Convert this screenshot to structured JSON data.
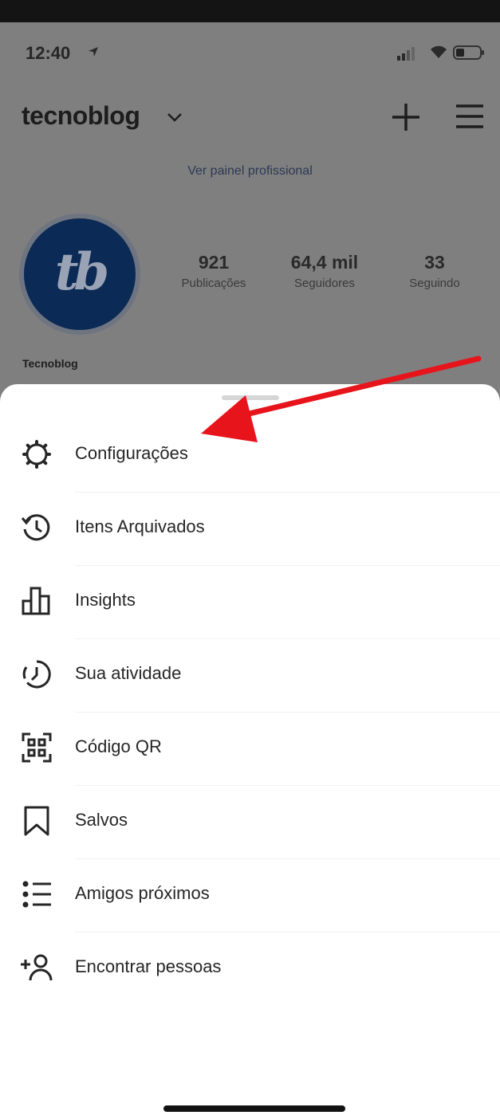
{
  "status_bar": {
    "time": "12:40",
    "icons": [
      "location-arrow-icon",
      "signal-icon",
      "wifi-icon",
      "battery-icon"
    ]
  },
  "header": {
    "account_name": "tecnoblog",
    "icons": [
      "chevron-down-icon",
      "plus-icon",
      "hamburger-menu-icon"
    ]
  },
  "professional_panel": "Ver painel profissional",
  "profile": {
    "avatar_text": "tb",
    "display_name": "Tecnoblog",
    "stats": [
      {
        "value": "921",
        "label": "Publicações"
      },
      {
        "value": "64,4 mil",
        "label": "Seguidores"
      },
      {
        "value": "33",
        "label": "Seguindo"
      }
    ]
  },
  "menu": {
    "items": [
      {
        "label": "Configurações",
        "icon": "settings-gear-icon"
      },
      {
        "label": "Itens Arquivados",
        "icon": "archive-history-icon"
      },
      {
        "label": "Insights",
        "icon": "bar-chart-icon"
      },
      {
        "label": "Sua atividade",
        "icon": "activity-clock-icon"
      },
      {
        "label": "Código QR",
        "icon": "qr-code-icon"
      },
      {
        "label": "Salvos",
        "icon": "bookmark-icon"
      },
      {
        "label": "Amigos próximos",
        "icon": "close-friends-list-icon"
      },
      {
        "label": "Encontrar pessoas",
        "icon": "add-person-icon"
      }
    ]
  },
  "annotation": {
    "arrow_color": "#e8141c"
  },
  "colors": {
    "overlay": "#7f7f7f",
    "sheet": "#ffffff",
    "text": "#262626"
  }
}
